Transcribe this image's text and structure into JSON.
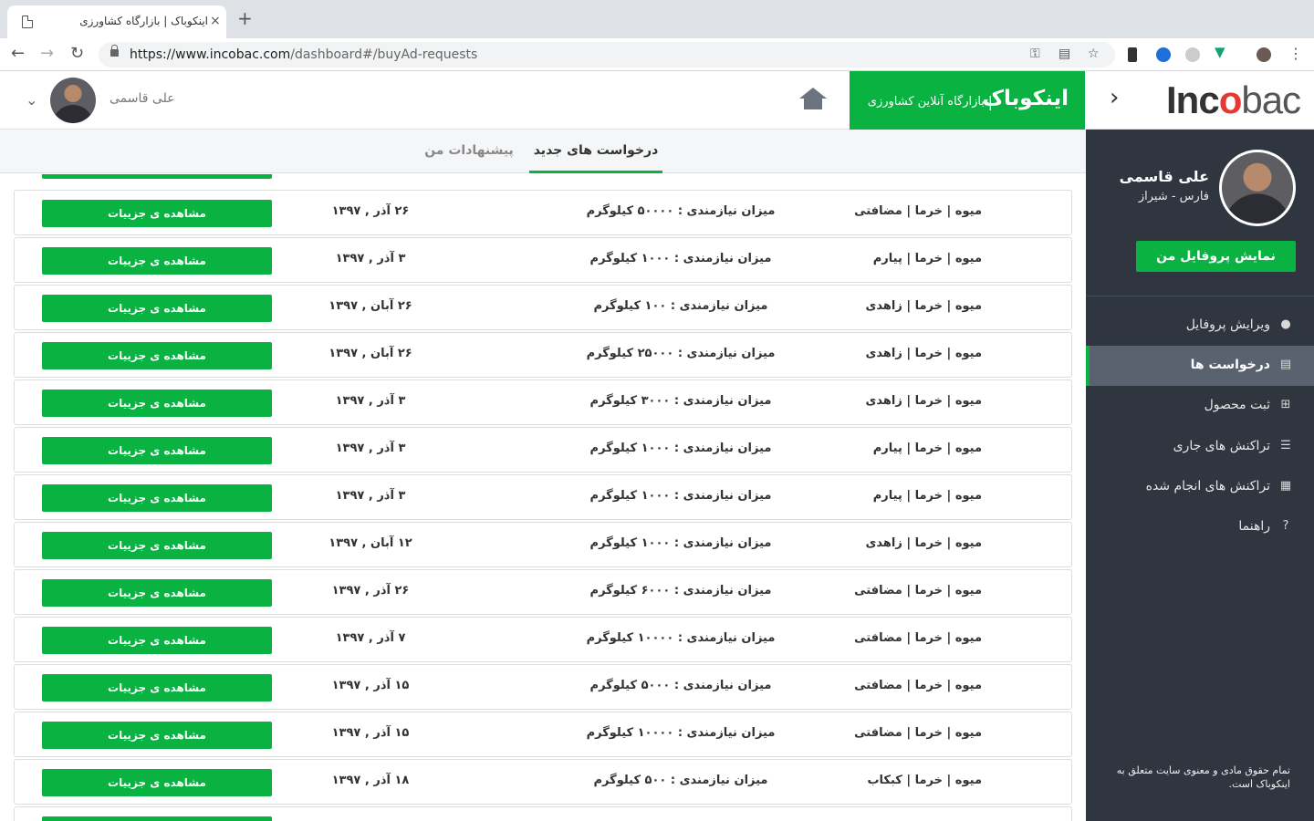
{
  "browser": {
    "tab_title": "اینکوباک | بازارگاه کشاورزی",
    "tab_close": "×",
    "new_tab": "+",
    "url_host": "https://www.incobac.com",
    "url_path": "/dashboard#/buyAd-requests"
  },
  "header": {
    "user_name": "علی قاسمی",
    "brand_title": "اینکوباک",
    "brand_separator": "|",
    "brand_subtitle": "بازارگاه آنلاین کشاورزی",
    "logo_part1": "Inc",
    "logo_o": "o",
    "logo_part2": "bac"
  },
  "sidebar": {
    "name": "علی قاسمی",
    "location": "فارس - شیراز",
    "profile_button": "نمایش پروفایل من",
    "items": [
      {
        "label": "ویرایش پروفایل",
        "icon": "user-icon",
        "glyph": "●"
      },
      {
        "label": "درخواست ها",
        "icon": "list-alt-icon",
        "glyph": "▤"
      },
      {
        "label": "ثبت محصول",
        "icon": "plus-square-icon",
        "glyph": "⊞"
      },
      {
        "label": "تراکنش های جاری",
        "icon": "list-icon",
        "glyph": "☰"
      },
      {
        "label": "تراکنش های انجام شده",
        "icon": "table-icon",
        "glyph": "▦"
      },
      {
        "label": "راهنما",
        "icon": "question-circle-icon",
        "glyph": "?"
      }
    ],
    "footer": "تمام حقوق مادی و معنوی سایت متعلق به اینکوباک است."
  },
  "tabs": {
    "new_requests": "درخواست های جدید",
    "my_offers": "پیشنهادات من"
  },
  "requests": [
    {
      "product": "میوه | خرما | مضافتی",
      "amount": "میزان نیازمندی : ۵۰۰۰۰ کیلوگرم",
      "date": "۲۶ آذر , ۱۳۹۷",
      "button": "مشاهده ی جزییات"
    },
    {
      "product": "میوه | خرما | پیارم",
      "amount": "میزان نیازمندی : ۱۰۰۰ کیلوگرم",
      "date": "۳ آذر , ۱۳۹۷",
      "button": "مشاهده ی جزییات"
    },
    {
      "product": "میوه | خرما | زاهدی",
      "amount": "میزان نیازمندی : ۱۰۰ کیلوگرم",
      "date": "۲۶ آبان , ۱۳۹۷",
      "button": "مشاهده ی جزییات"
    },
    {
      "product": "میوه | خرما | زاهدی",
      "amount": "میزان نیازمندی : ۲۵۰۰۰ کیلوگرم",
      "date": "۲۶ آبان , ۱۳۹۷",
      "button": "مشاهده ی جزییات"
    },
    {
      "product": "میوه | خرما | زاهدی",
      "amount": "میزان نیازمندی : ۳۰۰۰ کیلوگرم",
      "date": "۳ آذر , ۱۳۹۷",
      "button": "مشاهده ی جزییات"
    },
    {
      "product": "میوه | خرما | پیارم",
      "amount": "میزان نیازمندی : ۱۰۰۰ کیلوگرم",
      "date": "۳ آذر , ۱۳۹۷",
      "button": "مشاهده ی جزییات"
    },
    {
      "product": "میوه | خرما | پیارم",
      "amount": "میزان نیازمندی : ۱۰۰۰ کیلوگرم",
      "date": "۳ آذر , ۱۳۹۷",
      "button": "مشاهده ی جزییات"
    },
    {
      "product": "میوه | خرما | زاهدی",
      "amount": "میزان نیازمندی : ۱۰۰۰ کیلوگرم",
      "date": "۱۲ آبان , ۱۳۹۷",
      "button": "مشاهده ی جزییات"
    },
    {
      "product": "میوه | خرما | مضافتی",
      "amount": "میزان نیازمندی : ۶۰۰۰ کیلوگرم",
      "date": "۲۶ آذر , ۱۳۹۷",
      "button": "مشاهده ی جزییات"
    },
    {
      "product": "میوه | خرما | مضافتی",
      "amount": "میزان نیازمندی : ۱۰۰۰۰ کیلوگرم",
      "date": "۷ آذر , ۱۳۹۷",
      "button": "مشاهده ی جزییات"
    },
    {
      "product": "میوه | خرما | مضافتی",
      "amount": "میزان نیازمندی : ۵۰۰۰ کیلوگرم",
      "date": "۱۵ آذر , ۱۳۹۷",
      "button": "مشاهده ی جزییات"
    },
    {
      "product": "میوه | خرما | مضافتی",
      "amount": "میزان نیازمندی : ۱۰۰۰۰ کیلوگرم",
      "date": "۱۵ آذر , ۱۳۹۷",
      "button": "مشاهده ی جزییات"
    },
    {
      "product": "میوه | خرما | کبکاب",
      "amount": "میزان نیازمندی : ۵۰۰ کیلوگرم",
      "date": "۱۸ آذر , ۱۳۹۷",
      "button": "مشاهده ی جزییات"
    }
  ],
  "colors": {
    "accent": "#0ab241",
    "sidebar_bg": "#2f3640",
    "logo_red": "#e53935"
  }
}
